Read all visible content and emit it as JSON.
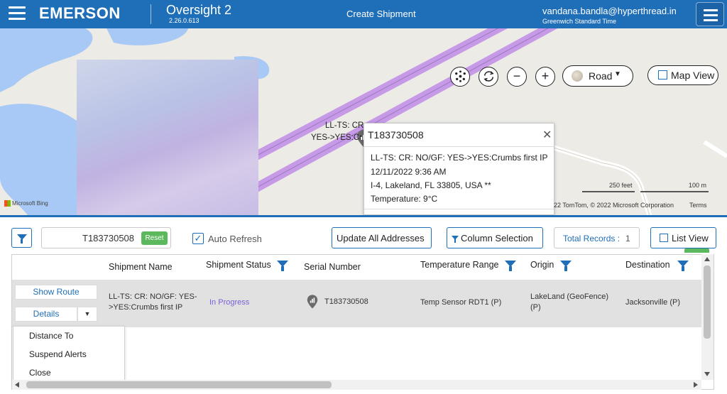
{
  "header": {
    "brand": "EMERSON",
    "app_name": "Oversight 2",
    "app_version": "2.26.0.613",
    "page_title": "Create Shipment",
    "user_email": "vandana.bandla@hyperthread.in",
    "timezone": "Greenwich Standard Time"
  },
  "map": {
    "controls": {
      "cluster_icon": "cluster-icon",
      "refresh_icon": "refresh-icon",
      "zoom_out": "−",
      "zoom_in": "+",
      "road_label": "Road",
      "map_view_label": "Map View"
    },
    "marker_label_line1": "LL-TS: CR",
    "marker_label_line2": "YES->YES:Cr",
    "attribution_bing": "Microsoft Bing",
    "scale_feet": "250 feet",
    "scale_meters": "100 m",
    "copyright": "22 TomTom, © 2022 Microsoft Corporation",
    "terms": "Terms",
    "popup": {
      "title": "T183730508",
      "line1": "LL-TS: CR: NO/GF: YES->YES:Crumbs first IP",
      "line2": "12/11/2022 9:36 AM",
      "line3": "I-4, Lakeland, FL 33805, USA **",
      "line4": "Temperature: 9°C"
    }
  },
  "toolbar": {
    "search_value": "T183730508",
    "reset_label": "Reset",
    "auto_refresh_label": "Auto Refresh",
    "auto_refresh_checked": "✓",
    "update_addresses_label": "Update All Addresses",
    "column_selection_label": "Column Selection",
    "total_records_label": "Total Records :",
    "total_records_value": "1",
    "list_view_label": "List View"
  },
  "grid": {
    "columns": [
      "Shipment Name",
      "Shipment Status",
      "Serial Number",
      "Temperature Range",
      "Origin",
      "Destination"
    ],
    "rows": [
      {
        "show_route": "Show Route",
        "details": "Details",
        "shipment_name": "LL-TS: CR: NO/GF: YES->YES:Crumbs first IP",
        "shipment_status": "In Progress",
        "serial_number": "T183730508",
        "temperature_range": "Temp Sensor RDT1 (P)",
        "origin": "LakeLand (GeoFence) (P)",
        "destination": "Jacksonville (P)"
      }
    ],
    "details_menu": [
      "Distance To",
      "Suspend Alerts",
      "Close"
    ]
  },
  "colors": {
    "header_blue": "#1f6eb8",
    "in_progress": "#7b5fd6",
    "reset_green": "#5cb85c",
    "route_purple": "#c79ae8"
  }
}
